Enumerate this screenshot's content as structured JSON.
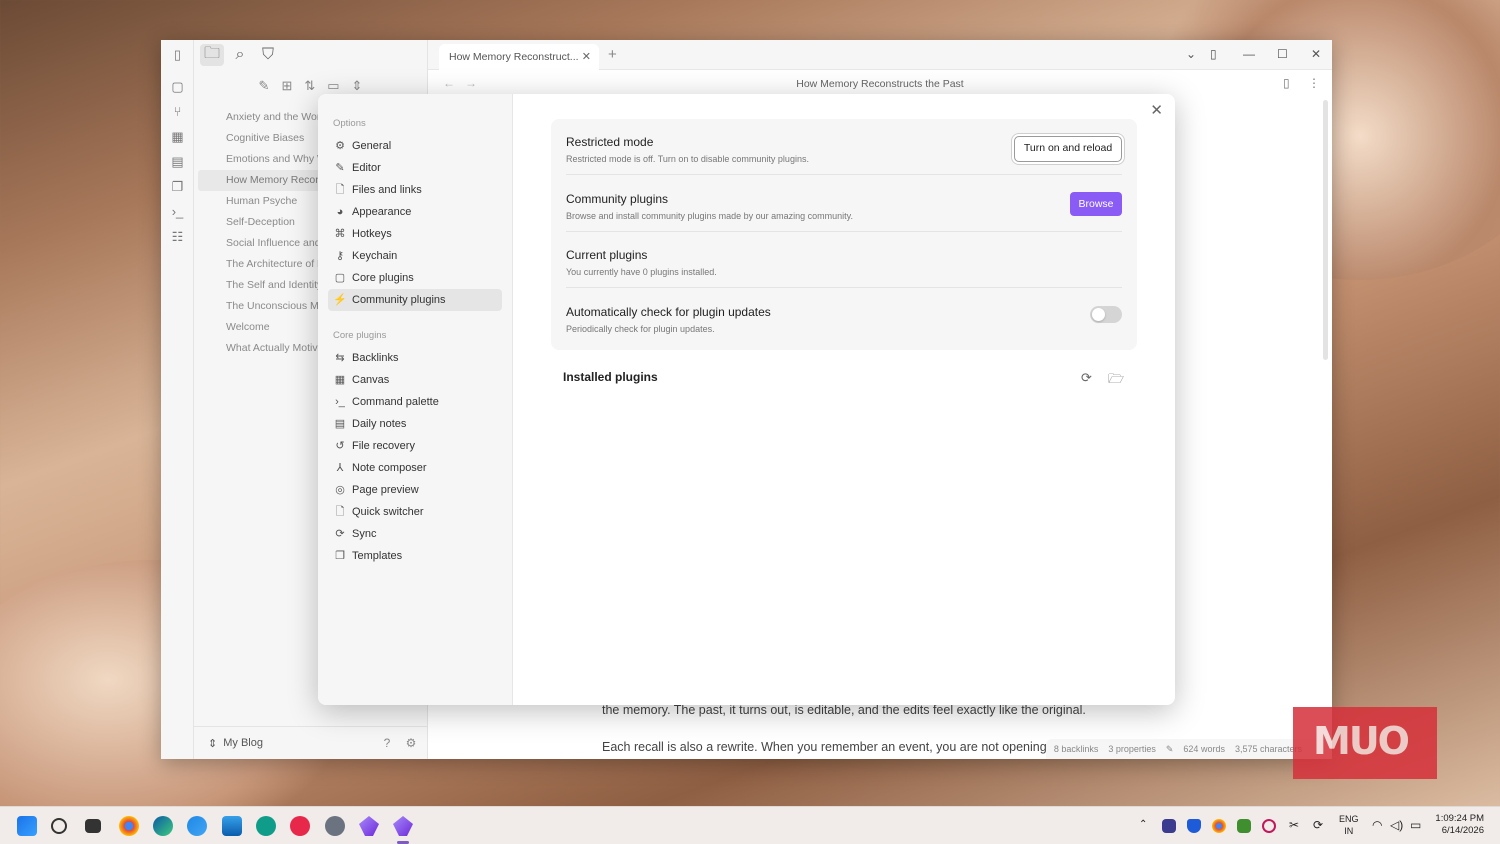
{
  "app": {
    "tab_title": "How Memory Reconstruct...",
    "note_title": "How Memory Reconstructs the Past",
    "vault_name": "My Blog"
  },
  "sidebar": {
    "files": [
      "Anxiety and the Worr",
      "Cognitive Biases",
      "Emotions and Why W",
      "How Memory Recons",
      "Human Psyche",
      "Self-Deception",
      "Social Influence and C",
      "The Architecture of H",
      "The Self and Identity",
      "The Unconscious Min",
      "Welcome",
      "What Actually Motiva"
    ]
  },
  "editor": {
    "line1": "the memory. The past, it turns out, is editable, and the edits feel exactly like the original.",
    "line2": "Each recall is also a rewrite. When you remember an event, you are not opening"
  },
  "statusbar": {
    "backlinks": "8 backlinks",
    "properties": "3 properties",
    "words": "624 words",
    "characters": "3,575 characters"
  },
  "settings": {
    "options_heading": "Options",
    "options": [
      {
        "icon": "gear-icon",
        "label": "General"
      },
      {
        "icon": "pencil-icon",
        "label": "Editor"
      },
      {
        "icon": "file-link-icon",
        "label": "Files and links"
      },
      {
        "icon": "palette-icon",
        "label": "Appearance"
      },
      {
        "icon": "command-icon",
        "label": "Hotkeys"
      },
      {
        "icon": "key-icon",
        "label": "Keychain"
      },
      {
        "icon": "box-icon",
        "label": "Core plugins"
      },
      {
        "icon": "plug-icon",
        "label": "Community plugins"
      }
    ],
    "core_heading": "Core plugins",
    "core": [
      {
        "icon": "backlinks-icon",
        "label": "Backlinks"
      },
      {
        "icon": "canvas-icon",
        "label": "Canvas"
      },
      {
        "icon": "terminal-icon",
        "label": "Command palette"
      },
      {
        "icon": "calendar-icon",
        "label": "Daily notes"
      },
      {
        "icon": "history-icon",
        "label": "File recovery"
      },
      {
        "icon": "merge-icon",
        "label": "Note composer"
      },
      {
        "icon": "preview-icon",
        "label": "Page preview"
      },
      {
        "icon": "file-search-icon",
        "label": "Quick switcher"
      },
      {
        "icon": "sync-icon",
        "label": "Sync"
      },
      {
        "icon": "copy-icon",
        "label": "Templates"
      }
    ],
    "restricted": {
      "name": "Restricted mode",
      "desc": "Restricted mode is off. Turn on to disable community plugins.",
      "button": "Turn on and reload"
    },
    "community": {
      "name": "Community plugins",
      "desc": "Browse and install community plugins made by our amazing community.",
      "button": "Browse"
    },
    "current": {
      "name": "Current plugins",
      "desc": "You currently have 0 plugins installed."
    },
    "auto_update": {
      "name": "Automatically check for plugin updates",
      "desc": "Periodically check for plugin updates.",
      "enabled": false
    },
    "installed_heading": "Installed plugins"
  },
  "watermark": "MUO",
  "taskbar": {
    "lang_top": "ENG",
    "lang_bottom": "IN",
    "time": "1:09:24 PM",
    "date": "6/14/2026"
  },
  "colors": {
    "accent": "#8a5cf5",
    "watermark": "#d6303a"
  }
}
